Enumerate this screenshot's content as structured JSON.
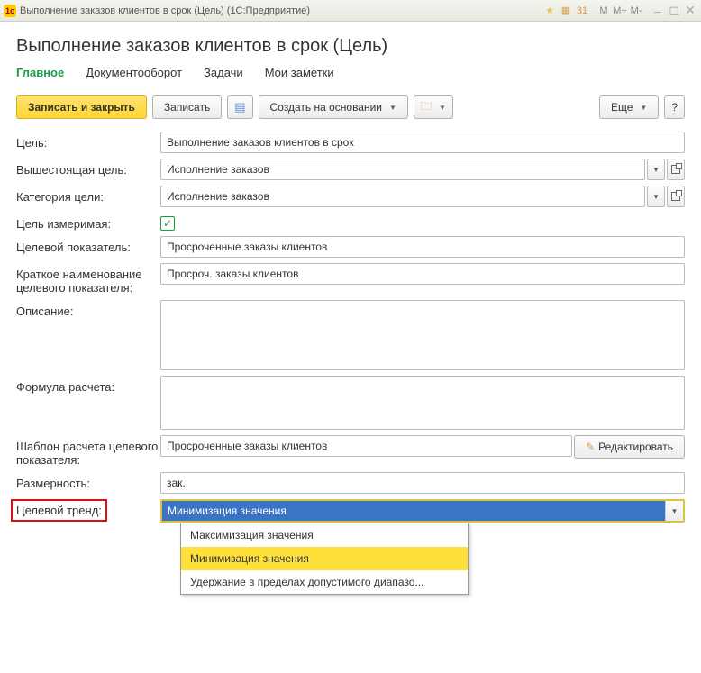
{
  "titlebar": {
    "title": "Выполнение заказов клиентов в срок (Цель)  (1С:Предприятие)"
  },
  "page": {
    "title": "Выполнение заказов клиентов в срок (Цель)"
  },
  "tabs": {
    "main": "Главное",
    "docflow": "Документооборот",
    "tasks": "Задачи",
    "notes": "Мои заметки"
  },
  "toolbar": {
    "save_close": "Записать и закрыть",
    "save": "Записать",
    "create_based": "Создать на основании",
    "more": "Еще",
    "help": "?",
    "edit": "Редактировать"
  },
  "labels": {
    "goal": "Цель:",
    "parent": "Вышестоящая цель:",
    "category": "Категория цели:",
    "measurable": "Цель измеримая:",
    "indicator": "Целевой показатель:",
    "short_name": "Краткое наименование целевого показателя:",
    "description": "Описание:",
    "formula": "Формула расчета:",
    "template": "Шаблон расчета целевого показателя:",
    "dimension": "Размерность:",
    "trend": "Целевой тренд:"
  },
  "values": {
    "goal": "Выполнение заказов клиентов в срок",
    "parent": "Исполнение заказов",
    "category": "Исполнение заказов",
    "measurable": true,
    "indicator": "Просроченные заказы клиентов",
    "short_name": "Просроч. заказы клиентов",
    "description": "",
    "formula": "",
    "template": "Просроченные заказы клиентов",
    "dimension": "зак.",
    "trend": "Минимизация значения"
  },
  "trend_options": [
    "Максимизация значения",
    "Минимизация значения",
    "Удержание в пределах допустимого диапазо..."
  ],
  "titlebar_controls": {
    "m": "М",
    "mplus": "М+",
    "mminus": "М-"
  }
}
